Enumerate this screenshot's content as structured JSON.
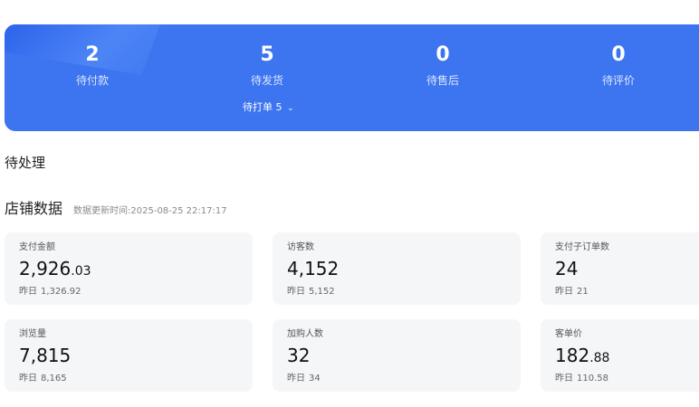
{
  "banner": {
    "stats": [
      {
        "value": "2",
        "label": "待付款"
      },
      {
        "value": "5",
        "label": "待发货"
      },
      {
        "value": "0",
        "label": "待售后"
      },
      {
        "value": "0",
        "label": "待评价"
      }
    ],
    "sub_order": {
      "label": "待打单 5",
      "icon": "chevron-down-icon"
    },
    "colors": {
      "background": "#3d74f0"
    }
  },
  "pending": {
    "title": "待处理"
  },
  "store": {
    "title": "店铺数据",
    "update_label": "数据更新时间:",
    "update_time": "2025-08-25 22:17:17"
  },
  "cards": [
    {
      "label": "支付金额",
      "value_int": "2,926",
      "value_dec": ".03",
      "prev_label": "昨日",
      "prev_value": "1,326.92"
    },
    {
      "label": "访客数",
      "value_int": "4,152",
      "value_dec": "",
      "prev_label": "昨日",
      "prev_value": "5,152"
    },
    {
      "label": "支付子订单数",
      "value_int": "24",
      "value_dec": "",
      "prev_label": "昨日",
      "prev_value": "21"
    },
    {
      "label": "浏览量",
      "value_int": "7,815",
      "value_dec": "",
      "prev_label": "昨日",
      "prev_value": "8,165"
    },
    {
      "label": "加购人数",
      "value_int": "32",
      "value_dec": "",
      "prev_label": "昨日",
      "prev_value": "34"
    },
    {
      "label": "客单价",
      "value_int": "182",
      "value_dec": ".88",
      "prev_label": "昨日",
      "prev_value": "110.58"
    }
  ]
}
